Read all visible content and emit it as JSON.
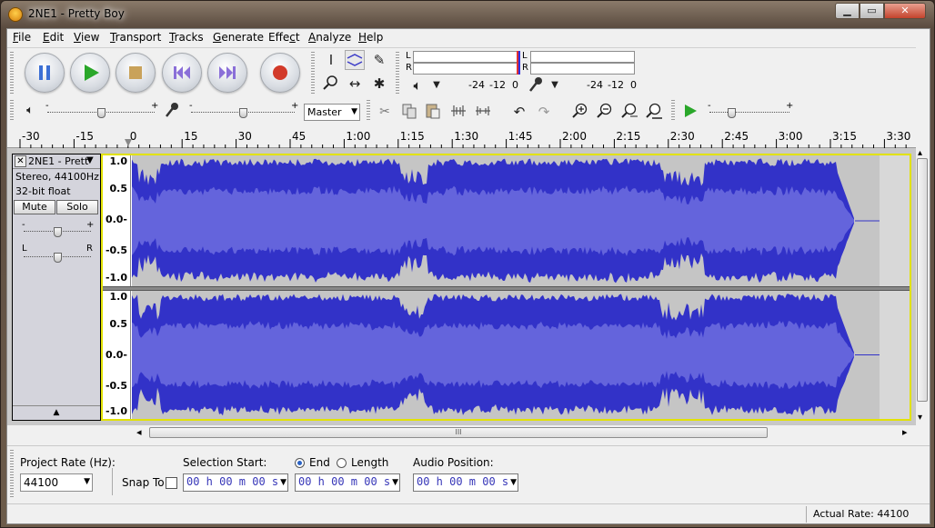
{
  "window": {
    "title": "2NE1 - Pretty Boy",
    "min_glyph": "▁",
    "max_glyph": "▭",
    "close_glyph": "✕"
  },
  "menu": [
    {
      "label": "File",
      "key": "F"
    },
    {
      "label": "Edit",
      "key": "E"
    },
    {
      "label": "View",
      "key": "V"
    },
    {
      "label": "Transport",
      "key": "T"
    },
    {
      "label": "Tracks",
      "key": "T"
    },
    {
      "label": "Generate",
      "key": "G"
    },
    {
      "label": "Effect",
      "key": "c"
    },
    {
      "label": "Analyze",
      "key": "A"
    },
    {
      "label": "Help",
      "key": "H"
    }
  ],
  "transport": {
    "pause_icon": "pause-icon",
    "play_icon": "play-icon",
    "stop_icon": "stop-icon",
    "skip_start_icon": "skip-start-icon",
    "skip_end_icon": "skip-end-icon",
    "record_icon": "record-icon"
  },
  "meters": {
    "left_label": "L",
    "right_label": "R",
    "ticks": [
      "-24",
      "-12",
      "0"
    ],
    "playback_ticks": [
      "-24",
      "-12",
      "0"
    ]
  },
  "mixer": {
    "minus": "-",
    "plus": "+",
    "playback_volume": 0.5,
    "recording_volume": 0.5,
    "input_source": "Master",
    "play_speed": 0.25
  },
  "ruler": {
    "ticks": [
      "-30",
      "-15",
      "0",
      "15",
      "30",
      "45",
      "1:00",
      "1:15",
      "1:30",
      "1:45",
      "2:00",
      "2:15",
      "2:30",
      "2:45",
      "3:00",
      "3:15",
      "3:30"
    ]
  },
  "track": {
    "name": "2NE1 - Prett",
    "close_glyph": "✕",
    "menu_glyph": "▼",
    "format": "Stereo, 44100Hz",
    "sample_type": "32-bit float",
    "mute_label": "Mute",
    "solo_label": "Solo",
    "gain_minus": "-",
    "gain_plus": "+",
    "pan_left": "L",
    "pan_right": "R",
    "collapse_glyph": "▲",
    "gain_value": 0.5,
    "pan_value": 0.5,
    "scale": [
      "1.0",
      "0.5",
      "0.0-",
      "-0.5",
      "-1.0"
    ],
    "colors": {
      "wave": "#3232c8",
      "rms": "#6464dc",
      "empty": "#c5c5c5",
      "selection_border": "#e2e200"
    }
  },
  "scroll": {
    "thumb_grip": "III",
    "left_arrow": "◂",
    "right_arrow": "▸",
    "up_arrow": "▴",
    "down_arrow": "▾"
  },
  "selection": {
    "project_rate_label": "Project Rate (Hz):",
    "project_rate_value": "44100",
    "snap_to_label": "Snap To",
    "selection_start_label": "Selection Start:",
    "end_label": "End",
    "length_label": "Length",
    "audio_position_label": "Audio Position:",
    "selection_start_value": "00 h 00 m 00 s",
    "end_value": "00 h 00 m 00 s",
    "audio_position_value": "00 h 00 m 00 s"
  },
  "status": {
    "actual_rate": "Actual Rate: 44100"
  }
}
